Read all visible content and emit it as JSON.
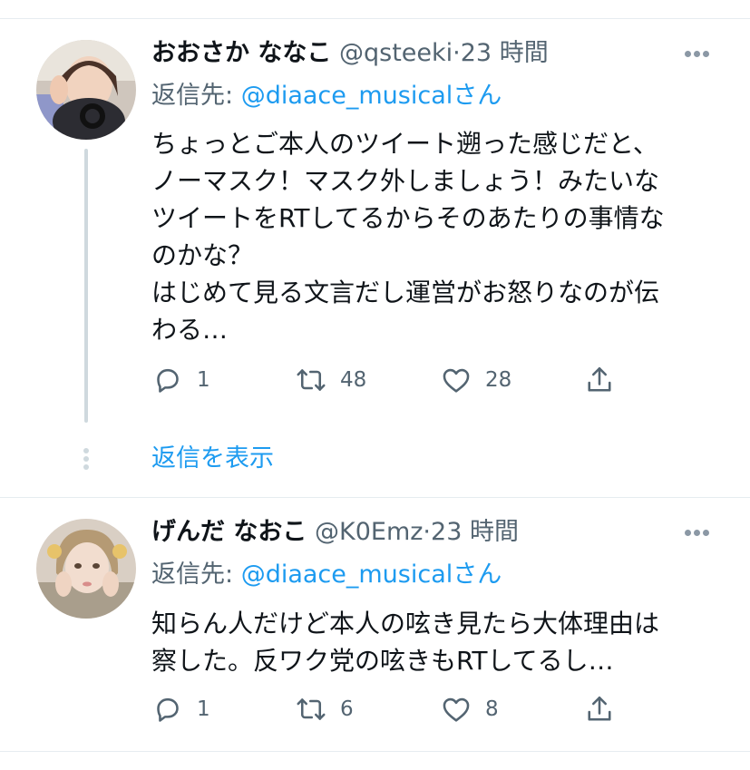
{
  "colors": {
    "accent": "#1d9bf0",
    "muted": "#536471",
    "text": "#0f1419",
    "divider": "#e6ecf0"
  },
  "tweets": [
    {
      "name": "おおさか ななこ",
      "handle": "@qsteeki",
      "separator": "·",
      "time": "23 時間",
      "reply_prefix": "返信先: ",
      "reply_mention": "@diaace_musical",
      "reply_suffix": "さん",
      "body_lines": [
        "ちょっとご本人のツイート遡った感じだと、",
        "ノーマスク！マスク外しましょう！みたいな",
        "ツイートをRTしてるからそのあたりの事情な",
        "のかな？",
        "はじめて見る文言だし運営がお怒りなのが伝",
        "わる…"
      ],
      "replies": "1",
      "retweets": "48",
      "likes": "28"
    },
    {
      "name": "げんだ なおこ",
      "handle": "@K0Emz",
      "separator": "·",
      "time": "23 時間",
      "reply_prefix": "返信先: ",
      "reply_mention": "@diaace_musical",
      "reply_suffix": "さん",
      "body_lines": [
        "知らん人だけど本人の呟き見たら大体理由は",
        "察した。反ワク党の呟きもRTしてるし…"
      ],
      "replies": "1",
      "retweets": "6",
      "likes": "8"
    }
  ],
  "show_replies": "返信を表示",
  "icons": [
    "more-horizontal-icon",
    "reply-icon",
    "retweet-icon",
    "like-icon",
    "share-icon"
  ]
}
